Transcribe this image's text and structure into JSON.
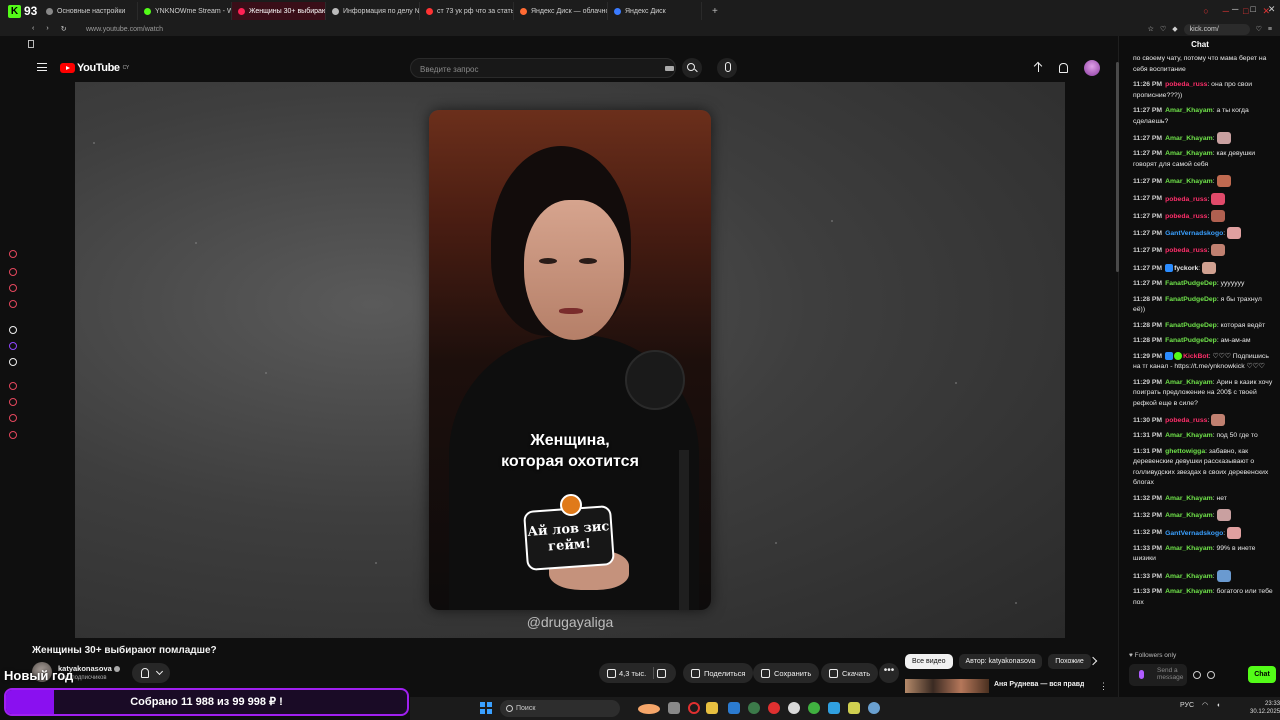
{
  "browser": {
    "kick_count": "93",
    "tabs": [
      {
        "label": "Основные настройки",
        "color": "#888888"
      },
      {
        "label": "YNKNOWme Stream - Wi",
        "color": "#53fc18"
      },
      {
        "label": "Женщины 30+ выбираю",
        "color": "#ff2255",
        "active": true
      },
      {
        "label": "Информация по делу №",
        "color": "#bbbbbb"
      },
      {
        "label": "ст 73 ук рф что за статья",
        "color": "#ff3333"
      },
      {
        "label": "Яндекс Диск — облачно",
        "color": "#ff6a33"
      },
      {
        "label": "Яндекс Диск",
        "color": "#3a7bff"
      }
    ],
    "new_tab": "+",
    "url": "www.youtube.com/watch",
    "kick_url": "kick.com/"
  },
  "youtube": {
    "logo_text": "YouTube",
    "logo_region": "CY",
    "search_placeholder": "Введите запрос"
  },
  "video": {
    "caption_line1": "Женщина,",
    "caption_line2": "которая охотится",
    "sticker_text": "Ай лов зис гейм!",
    "watermark": "@drugayaliga",
    "title": "Женщины 30+ выбирают помладше?",
    "channel": "katyakonasova",
    "subscribers": "тыс. подписчиков"
  },
  "actions": {
    "likes": "4,3 тыс.",
    "share": "Поделиться",
    "save": "Сохранить",
    "download": "Скачать",
    "more": "•••"
  },
  "recommendations": {
    "chips": [
      "Все видео",
      "Автор: katyakonasova",
      "Похожие"
    ],
    "first_title": "Аня Руднева — вся правда о"
  },
  "overlay": {
    "new_year": "Новый год",
    "goal_text": "Собрано 11 988  из 99 998 ₽ !",
    "goal_fraction": 0.12
  },
  "taskbar": {
    "search_label": "Поиск",
    "lang": "РУС",
    "time": "23:33",
    "date": "30.12.2025"
  },
  "chat": {
    "header": "Chat",
    "messages": [
      {
        "time": "",
        "user": "",
        "color": "#e8e8e8",
        "text": "по своему чату, потому что мама берет на себя воспитание"
      },
      {
        "time": "11:26 PM",
        "user": "pobeda_russ",
        "color": "#ff2e6a",
        "text": ": она про свои прописние???))"
      },
      {
        "time": "11:27 PM",
        "user": "Amar_Khayam",
        "color": "#6fe24a",
        "text": ": а ты когда сделаешь?"
      },
      {
        "time": "11:27 PM",
        "user": "Amar_Khayam",
        "color": "#6fe24a",
        "text": ":",
        "emote": "#c9a0a0"
      },
      {
        "time": "11:27 PM",
        "user": "Amar_Khayam",
        "color": "#6fe24a",
        "text": ": как девушки говорят для самой себя"
      },
      {
        "time": "11:27 PM",
        "user": "Amar_Khayam",
        "color": "#6fe24a",
        "text": ":",
        "emote": "#c06a50"
      },
      {
        "time": "11:27 PM",
        "user": "pobeda_russ",
        "color": "#ff2e6a",
        "text": ":",
        "emote": "#e04a6a"
      },
      {
        "time": "11:27 PM",
        "user": "pobeda_russ",
        "color": "#ff2e6a",
        "text": ":",
        "emote": "#b06050"
      },
      {
        "time": "11:27 PM",
        "user": "GantVernadskogo",
        "color": "#3aa0ff",
        "text": ":",
        "emote": "#e0a0a0"
      },
      {
        "time": "11:27 PM",
        "user": "pobeda_russ",
        "color": "#ff2e6a",
        "text": ":",
        "emote": "#c08070"
      },
      {
        "time": "11:27 PM",
        "user": "fyckork",
        "color": "#e8e8e8",
        "badge": true,
        "text": ":",
        "emote": "#d0a090"
      },
      {
        "time": "11:27 PM",
        "user": "FanatPudgeDep",
        "color": "#6fe24a",
        "text": ": ууууууу"
      },
      {
        "time": "11:28 PM",
        "user": "FanatPudgeDep",
        "color": "#6fe24a",
        "text": ": я бы трахнул её))"
      },
      {
        "time": "11:28 PM",
        "user": "FanatPudgeDep",
        "color": "#6fe24a",
        "text": ": которая ведёт"
      },
      {
        "time": "11:28 PM",
        "user": "FanatPudgeDep",
        "color": "#6fe24a",
        "text": ": ам-ам-ам"
      },
      {
        "time": "11:29 PM",
        "user": "KickBot",
        "color": "#ff2e6a",
        "badge": true,
        "badge2": true,
        "text": ": ♡♡♡ Подпишись на тг канал - https://t.me/ynknowkick ♡♡♡"
      },
      {
        "time": "11:29 PM",
        "user": "Amar_Khayam",
        "color": "#6fe24a",
        "text": ": Арин в казик хочу поиграть предложение на 200$ с твоей рефкой еще в силе?"
      },
      {
        "time": "11:30 PM",
        "user": "pobeda_russ",
        "color": "#ff2e6a",
        "text": ":",
        "emote": "#c08070"
      },
      {
        "time": "11:31 PM",
        "user": "Amar_Khayam",
        "color": "#6fe24a",
        "text": ": под 50 где то"
      },
      {
        "time": "11:31 PM",
        "user": "ghettowigga",
        "color": "#6fe24a",
        "text": ": забавно, как деревенские девушки рассказывают о голливудских звездах в своих деревенских блогах"
      },
      {
        "time": "11:32 PM",
        "user": "Amar_Khayam",
        "color": "#6fe24a",
        "text": ": нет"
      },
      {
        "time": "11:32 PM",
        "user": "Amar_Khayam",
        "color": "#6fe24a",
        "text": ":",
        "emote": "#c9a0a0"
      },
      {
        "time": "11:32 PM",
        "user": "GantVernadskogo",
        "color": "#3aa0ff",
        "text": ":",
        "emote": "#e0a0a0"
      },
      {
        "time": "11:33 PM",
        "user": "Amar_Khayam",
        "color": "#6fe24a",
        "text": ": 99% в инете шизики"
      },
      {
        "time": "11:33 PM",
        "user": "Amar_Khayam",
        "color": "#6fe24a",
        "text": ":",
        "emote": "#6a9ad0"
      },
      {
        "time": "11:33 PM",
        "user": "Amar_Khayam",
        "color": "#6fe24a",
        "text": ": богатого или тебе пох"
      }
    ],
    "followers_only": "♥ Followers only",
    "input_placeholder": "Send a message",
    "send_label": "Chat"
  }
}
